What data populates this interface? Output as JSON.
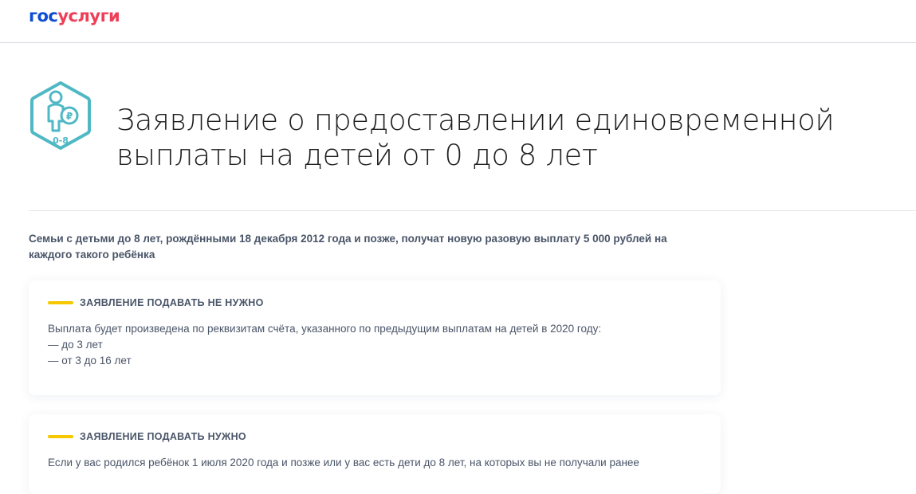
{
  "header": {
    "logo": {
      "part1": "гос",
      "part2": "услуги"
    }
  },
  "hero": {
    "icon_badge": "0-8",
    "icon_currency": "₽",
    "title_line1": "Заявление о предоставлении единовременной",
    "title_line2": "выплаты на детей от 0 до 8 лет"
  },
  "intro": {
    "text": "Семьи с детьми до 8 лет, рождёнными 18 декабря 2012 года и позже, получат новую разовую выплату 5 000 рублей на каждого такого ребёнка"
  },
  "cards": [
    {
      "heading": "ЗАЯВЛЕНИЕ ПОДАВАТЬ НЕ НУЖНО",
      "lines": [
        "Выплата будет произведена по реквизитам счёта, указанного по предыдущим выплатам на детей в 2020 году:",
        "— до 3 лет",
        "— от 3 до 16 лет"
      ]
    },
    {
      "heading": "ЗАЯВЛЕНИЕ ПОДАВАТЬ НУЖНО",
      "lines": [
        "Если у вас родился ребёнок 1 июля 2020 года и позже или у вас есть дети до 8 лет, на которых вы не получали ранее"
      ]
    }
  ],
  "colors": {
    "brand_blue": "#0d4cd3",
    "brand_red": "#ee3f58",
    "icon_teal": "#4fb8c4",
    "accent_yellow": "#f5c800"
  },
  "icons": {
    "hero": "child-with-coin-hexagon-icon"
  }
}
